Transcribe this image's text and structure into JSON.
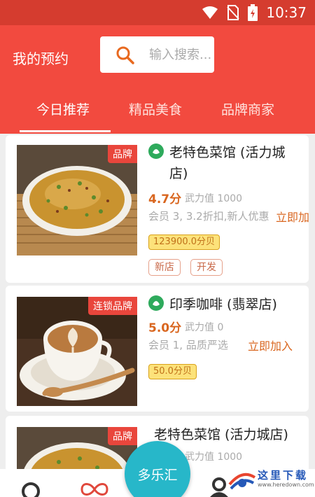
{
  "status_bar": {
    "time": "10:37"
  },
  "header": {
    "title": "我的预约",
    "search_placeholder": "输入搜索..."
  },
  "tabs": [
    {
      "label": "今日推荐",
      "active": true
    },
    {
      "label": "精品美食",
      "active": false
    },
    {
      "label": "品牌商家",
      "active": false
    }
  ],
  "cards": [
    {
      "ribbon": "品牌",
      "name": "老特色菜馆 (活力城店)",
      "score": "4.7分",
      "power": "武力值 1000",
      "member": "会员 3, 3.2折扣,新人优惠",
      "join": "立即加入",
      "price": "123900.0分贝",
      "tags": [
        "新店",
        "开发"
      ]
    },
    {
      "ribbon": "连锁品牌",
      "name": "印季咖啡 (翡翠店)",
      "score": "5.0分",
      "power": "武力值 0",
      "member": "会员 1, 品质严选",
      "join": "立即加入",
      "price": "50.0分贝"
    },
    {
      "ribbon": "品牌",
      "name": "老特色菜馆 (活力城店)",
      "power": "武力值 1000"
    }
  ],
  "fab": {
    "label": "多乐汇"
  },
  "watermark": {
    "text": "这里下载",
    "url": "www.heredown.com"
  },
  "colors": {
    "header": "#f24a3f",
    "accent": "#d9661f",
    "fab": "#27b7c9"
  }
}
